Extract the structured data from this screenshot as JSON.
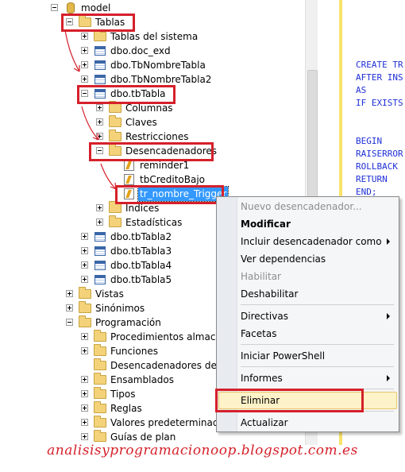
{
  "tree": {
    "root": "model",
    "tablas": "Tablas",
    "tablas_sistema": "Tablas del sistema",
    "doc_exd": "dbo.doc_exd",
    "tbnombretabla": "dbo.TbNombreTabla",
    "tbnombretabla2": "dbo.TbNombreTabla2",
    "tbtabla": "dbo.tbTabla",
    "columnas": "Columnas",
    "claves": "Claves",
    "restricciones": "Restricciones",
    "desencadenadores": "Desencadenadores",
    "trigger1": "reminder1",
    "trigger2": "tbCreditoBajo",
    "trigger3": "tr_nombre_Trigger",
    "indices": "Índices",
    "estadisticas": "Estadísticas",
    "tbtabla2": "dbo.tbTabla2",
    "tbtabla3": "dbo.tbTabla3",
    "tbtabla4": "dbo.tbTabla4",
    "tbtabla5": "dbo.tbTabla5",
    "vistas": "Vistas",
    "sinonimos": "Sinónimos",
    "programacion": "Programación",
    "proc_alm": "Procedimientos almacena",
    "funciones": "Funciones",
    "desenc_bd": "Desencadenadores de bas",
    "ensamblados": "Ensamblados",
    "tipos": "Tipos",
    "reglas": "Reglas",
    "valores": "Valores predeterminados",
    "guias": "Guías de plan"
  },
  "editor": {
    "line1": "CREATE TR",
    "line2": "AFTER INS",
    "line3": "AS",
    "line4": "IF EXISTS",
    "line5": "BEGIN",
    "line6": "RAISERROR",
    "line7": "ROLLBACK",
    "line8": "RETURN",
    "line9": "END;"
  },
  "context_menu": {
    "nuevo": "Nuevo desencadenador...",
    "modificar": "Modificar",
    "incluir": "Incluir desencadenador como",
    "ver_dep": "Ver dependencias",
    "habilitar": "Habilitar",
    "deshabilitar": "Deshabilitar",
    "directivas": "Directivas",
    "facetas": "Facetas",
    "powershell": "Iniciar PowerShell",
    "informes": "Informes",
    "eliminar": "Eliminar",
    "actualizar": "Actualizar"
  },
  "footer": {
    "url": "analisisyprogramacionoop.blogspot.com.es"
  },
  "colors": {
    "highlight": "#d5202a",
    "selection": "#3399ff",
    "code": "#1f2fd6"
  }
}
